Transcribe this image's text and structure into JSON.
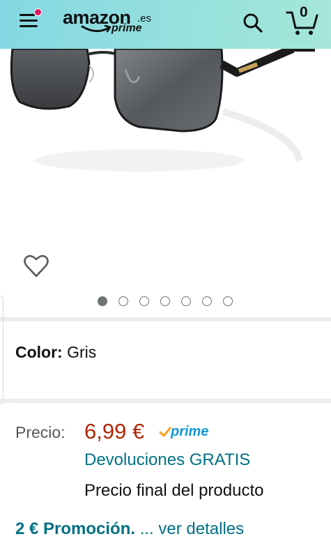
{
  "header": {
    "logo_word": "amazon",
    "logo_tld": ".es",
    "logo_sub": "prime",
    "cart_count": "0",
    "colors": {
      "bar_start": "#84d8e3",
      "bar_end": "#a5e7d9",
      "notification_dot": "#e2195d"
    },
    "icons": [
      "menu-icon",
      "search-icon",
      "cart-icon"
    ]
  },
  "gallery": {
    "image_count": 7,
    "active_index": 0,
    "wishlist_icon": "heart-outline-icon"
  },
  "color_selector": {
    "label": "Color:",
    "value": "Gris"
  },
  "pricing": {
    "price_label": "Precio:",
    "price_value": "6,99 €",
    "price_color": "#b12704",
    "prime_word": "prime",
    "prime_color": "#1399d6",
    "returns_link": "Devoluciones GRATIS",
    "final_price_note": "Precio final del producto"
  },
  "promotion": {
    "bold_text": "2 € Promoción.",
    "link_text": " ... ver detalles",
    "color": "#007185"
  }
}
